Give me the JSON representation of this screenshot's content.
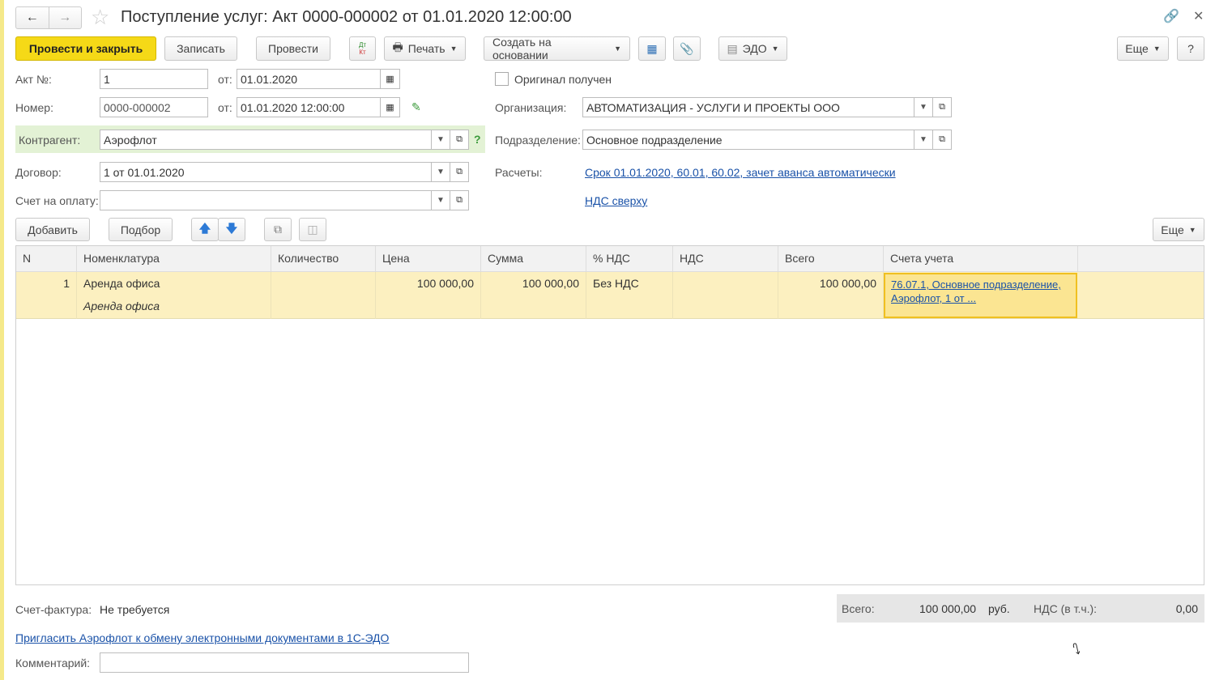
{
  "title": "Поступление услуг: Акт 0000-000002 от 01.01.2020 12:00:00",
  "toolbar": {
    "post_close": "Провести и закрыть",
    "save": "Записать",
    "post": "Провести",
    "dtkt_dt": "Дт",
    "dtkt_kt": "Кт",
    "print": "Печать",
    "create_based": "Создать на основании",
    "edo": "ЭДО",
    "more": "Еще",
    "help": "?"
  },
  "form": {
    "act_no_label": "Акт №:",
    "act_no": "1",
    "from_label": "от:",
    "act_date": "01.01.2020",
    "number_label": "Номер:",
    "number": "0000-000002",
    "doc_date": "01.01.2020 12:00:00",
    "original_label": "Оригинал получен",
    "original_checked": false,
    "org_label": "Организация:",
    "org": "АВТОМАТИЗАЦИЯ - УСЛУГИ И ПРОЕКТЫ ООО",
    "counterparty_label": "Контрагент:",
    "counterparty": "Аэрофлот",
    "help_q": "?",
    "division_label": "Подразделение:",
    "division": "Основное подразделение",
    "contract_label": "Договор:",
    "contract": "1 от 01.01.2020",
    "settlements_label": "Расчеты:",
    "settlements": "Срок 01.01.2020, 60.01, 60.02, зачет аванса автоматически",
    "invoice_label": "Счет на оплату:",
    "invoice": "",
    "vat_link": "НДС сверху"
  },
  "table_toolbar": {
    "add": "Добавить",
    "pick": "Подбор",
    "more": "Еще"
  },
  "table": {
    "columns": [
      "N",
      "Номенклатура",
      "Количество",
      "Цена",
      "Сумма",
      "% НДС",
      "НДС",
      "Всего",
      "Счета учета"
    ],
    "rows": [
      {
        "n": "1",
        "item": "Аренда офиса",
        "item_sub": "Аренда офиса",
        "qty": "",
        "price": "100 000,00",
        "sum": "100 000,00",
        "vat_rate": "Без НДС",
        "vat": "",
        "total": "100 000,00",
        "accounts": "76.07.1, Основное подразделение, Аэрофлот, 1 от ..."
      }
    ]
  },
  "footer": {
    "sf_label": "Счет-фактура:",
    "sf_value": "Не требуется",
    "total_label": "Всего:",
    "total": "100 000,00",
    "currency": "руб.",
    "vat_label": "НДС (в т.ч.):",
    "vat": "0,00",
    "invite_link": "Пригласить Аэрофлот к обмену электронными документами в 1С-ЭДО",
    "comment_label": "Комментарий:",
    "comment": ""
  }
}
